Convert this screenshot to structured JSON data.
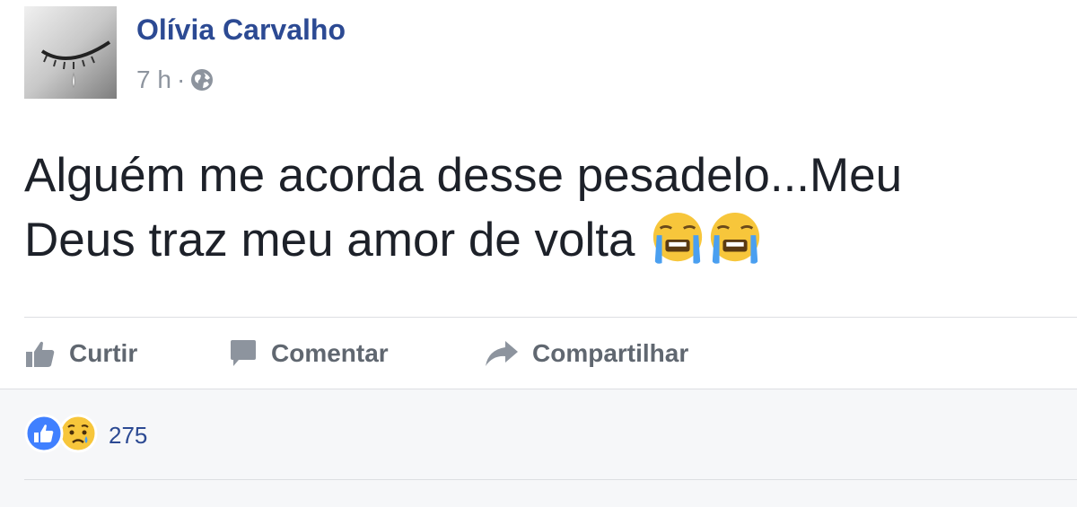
{
  "post": {
    "author": "Olívia Carvalho",
    "time": "7 h",
    "separator": "·",
    "visibility_icon": "globe-icon",
    "text_line_1": "Alguém me acorda desse pesadelo...Meu",
    "text_line_2": "Deus traz meu amor de volta",
    "emojis": [
      "loudly-crying-face-icon",
      "loudly-crying-face-icon"
    ]
  },
  "actions": {
    "like_label": "Curtir",
    "comment_label": "Comentar",
    "share_label": "Compartilhar"
  },
  "reactions": {
    "icons": [
      "like-reaction-icon",
      "sad-reaction-icon"
    ],
    "count": "275"
  },
  "colors": {
    "author_blue": "#2c4a93",
    "meta_gray": "#8d949e",
    "action_gray": "#606770",
    "text_dark": "#1d2129",
    "like_blue": "#4080ff",
    "emoji_yellow": "#f7c63b",
    "footer_bg": "#f6f7f9"
  }
}
